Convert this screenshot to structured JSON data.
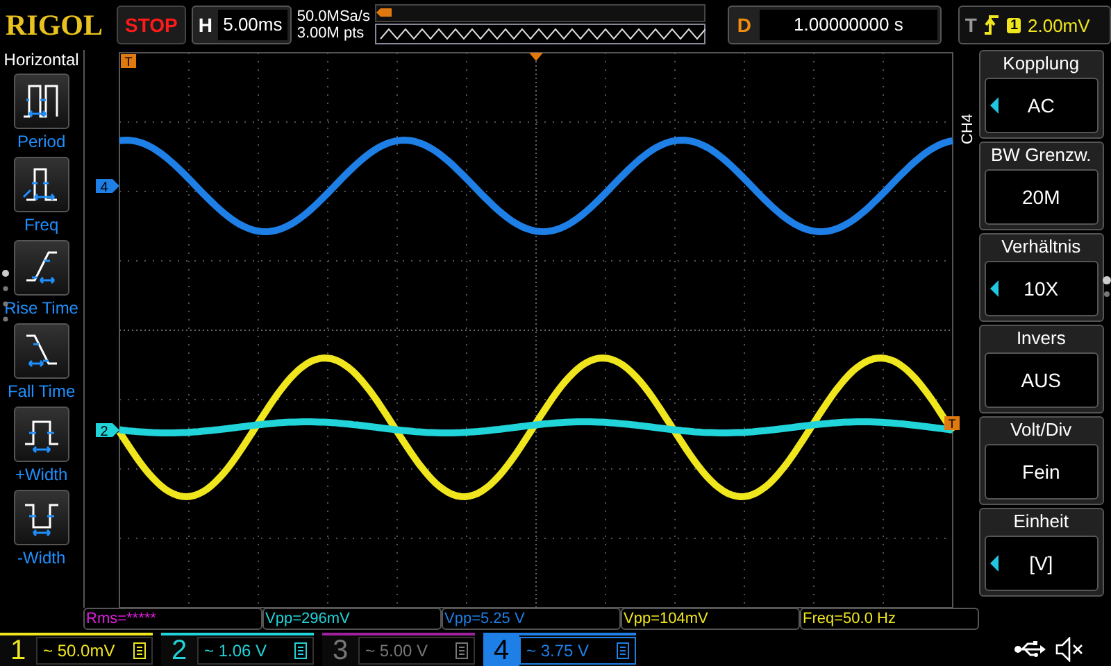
{
  "brand": "RIGOL",
  "run_state": "STOP",
  "horizontal": {
    "label": "H",
    "value": "5.00ms"
  },
  "acquisition": {
    "sample_rate": "50.0MSa/s",
    "memory_depth": "3.00M pts"
  },
  "delay": {
    "label": "D",
    "value": "1.00000000 s"
  },
  "trigger": {
    "label": "T",
    "source": "1",
    "level": "2.00mV"
  },
  "left_menu": {
    "title": "Horizontal",
    "items": [
      {
        "label": "Period",
        "kind": "period"
      },
      {
        "label": "Freq",
        "kind": "freq"
      },
      {
        "label": "Rise Time",
        "kind": "rise"
      },
      {
        "label": "Fall Time",
        "kind": "fall"
      },
      {
        "label": "+Width",
        "kind": "pwidth"
      },
      {
        "label": "-Width",
        "kind": "nwidth"
      }
    ]
  },
  "markers": {
    "trigger_position": "T",
    "trigger_level": "T",
    "channels": [
      {
        "label": "4",
        "color": "#1e7fe6"
      },
      {
        "label": "2",
        "color": "#21d4d9"
      }
    ]
  },
  "right_menu": {
    "channel": "CH4",
    "items": [
      {
        "title": "Kopplung",
        "value": "AC",
        "selectable": true
      },
      {
        "title": "BW Grenzw.",
        "value": "20M",
        "selectable": false
      },
      {
        "title": "Verhältnis",
        "value": "10X",
        "selectable": true
      },
      {
        "title": "Invers",
        "value": "AUS",
        "selectable": false
      },
      {
        "title": "Volt/Div",
        "value": "Fein",
        "selectable": false
      },
      {
        "title": "Einheit",
        "value": "[V]",
        "selectable": true
      }
    ]
  },
  "measurements": [
    {
      "text": "Rms=*****",
      "color": "#e01ee0"
    },
    {
      "text": "Vpp=296mV",
      "color": "#21d4d9"
    },
    {
      "text": "Vpp=5.25 V",
      "color": "#1e7fe6"
    },
    {
      "text": "Vpp=104mV",
      "color": "#f0e61e"
    },
    {
      "text": "Freq=50.0 Hz",
      "color": "#f0e61e"
    }
  ],
  "channels": [
    {
      "number": "1",
      "coupling": "~",
      "scale": "50.0mV",
      "color": "#f0e61e",
      "on": true,
      "selected": false
    },
    {
      "number": "2",
      "coupling": "~",
      "scale": "1.06 V",
      "color": "#21d4d9",
      "on": true,
      "selected": false
    },
    {
      "number": "3",
      "coupling": "~",
      "scale": "5.00 V",
      "color": "#a020a0",
      "on": false,
      "selected": false
    },
    {
      "number": "4",
      "coupling": "~",
      "scale": "3.75 V",
      "color": "#1e7fe6",
      "on": true,
      "selected": true
    }
  ]
}
